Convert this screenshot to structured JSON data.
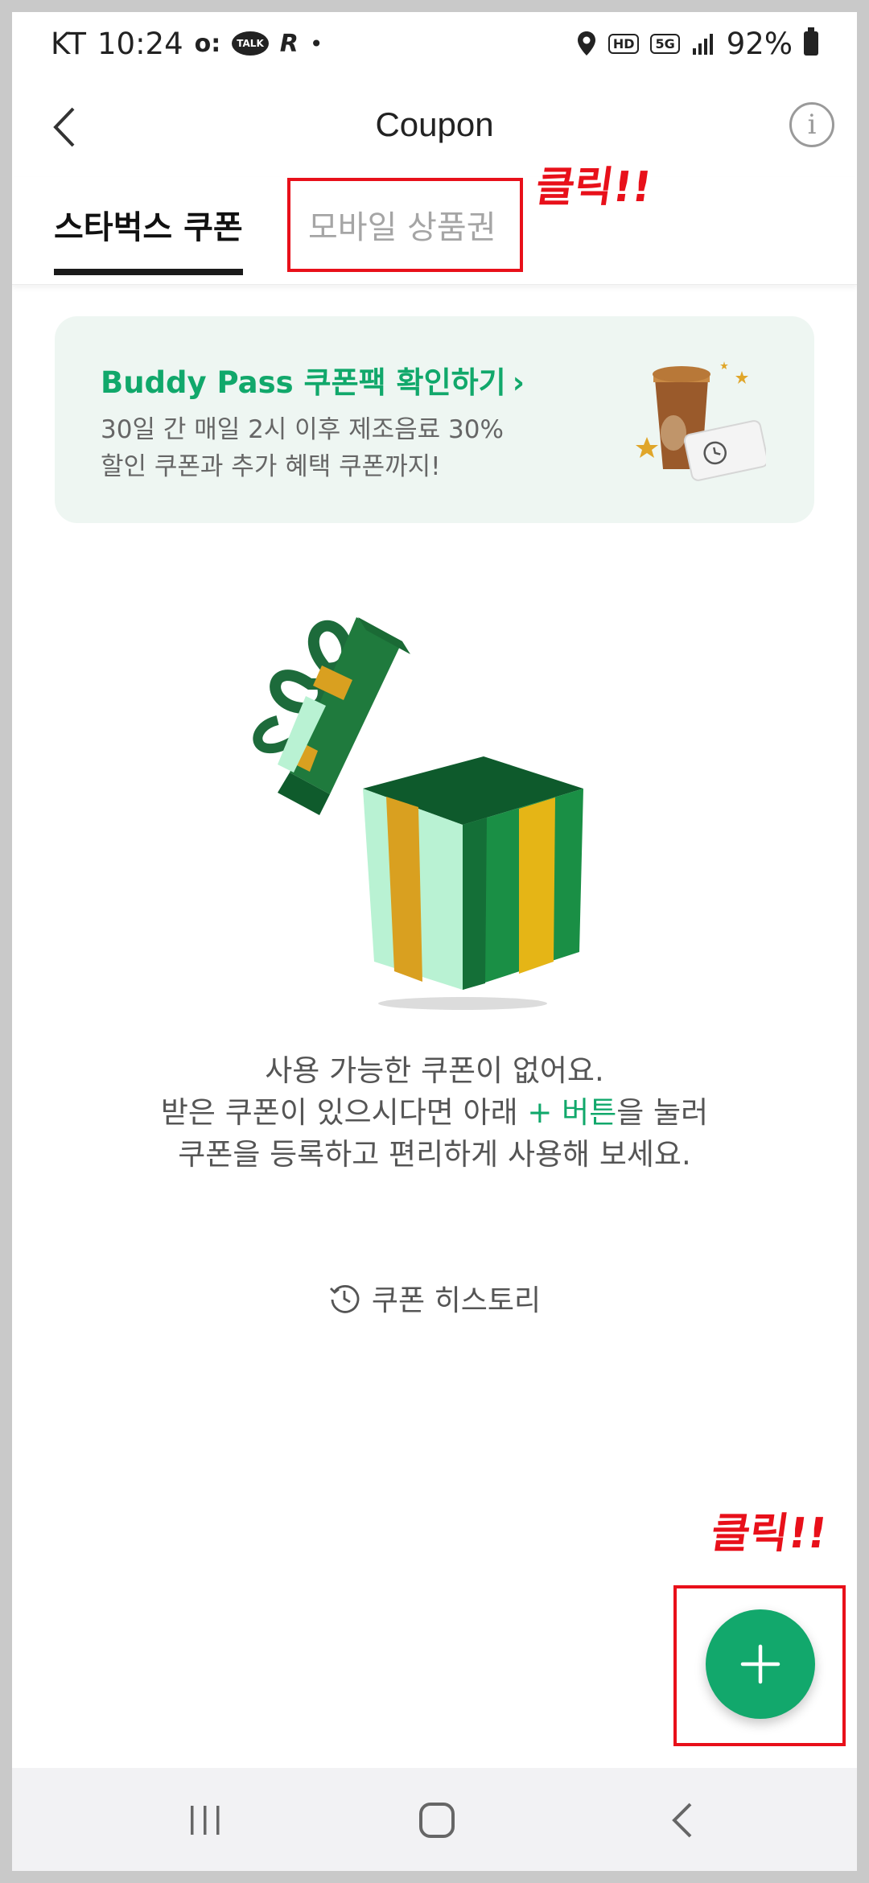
{
  "status_bar": {
    "carrier": "KT",
    "time": "10:24",
    "talk_label": "TALK",
    "network": "5G",
    "hd_label": "HD",
    "battery": "92%"
  },
  "header": {
    "title": "Coupon"
  },
  "tabs": [
    {
      "label": "스타벅스 쿠폰",
      "selected": true
    },
    {
      "label": "모바일 상품권",
      "selected": false
    }
  ],
  "annotations": {
    "tab_click": "클릭!!",
    "fab_click": "클릭!!",
    "color": "#e8101a"
  },
  "banner": {
    "title": "Buddy Pass 쿠폰팩 확인하기",
    "line1": "30일 간 매일 2시 이후 제조음료 30%",
    "line2": "할인 쿠폰과 추가 혜택 쿠폰까지!"
  },
  "empty_state": {
    "line1": "사용 가능한 쿠폰이 없어요.",
    "line2_before": "받은 쿠폰이 있으시다면 아래 ",
    "line2_highlight": "+ 버튼",
    "line2_after": "을 눌러",
    "line3": "쿠폰을 등록하고 편리하게 사용해 보세요."
  },
  "history": {
    "label": "쿠폰 히스토리"
  },
  "colors": {
    "brand_green": "#11a86b",
    "banner_bg": "#eef6f2"
  }
}
